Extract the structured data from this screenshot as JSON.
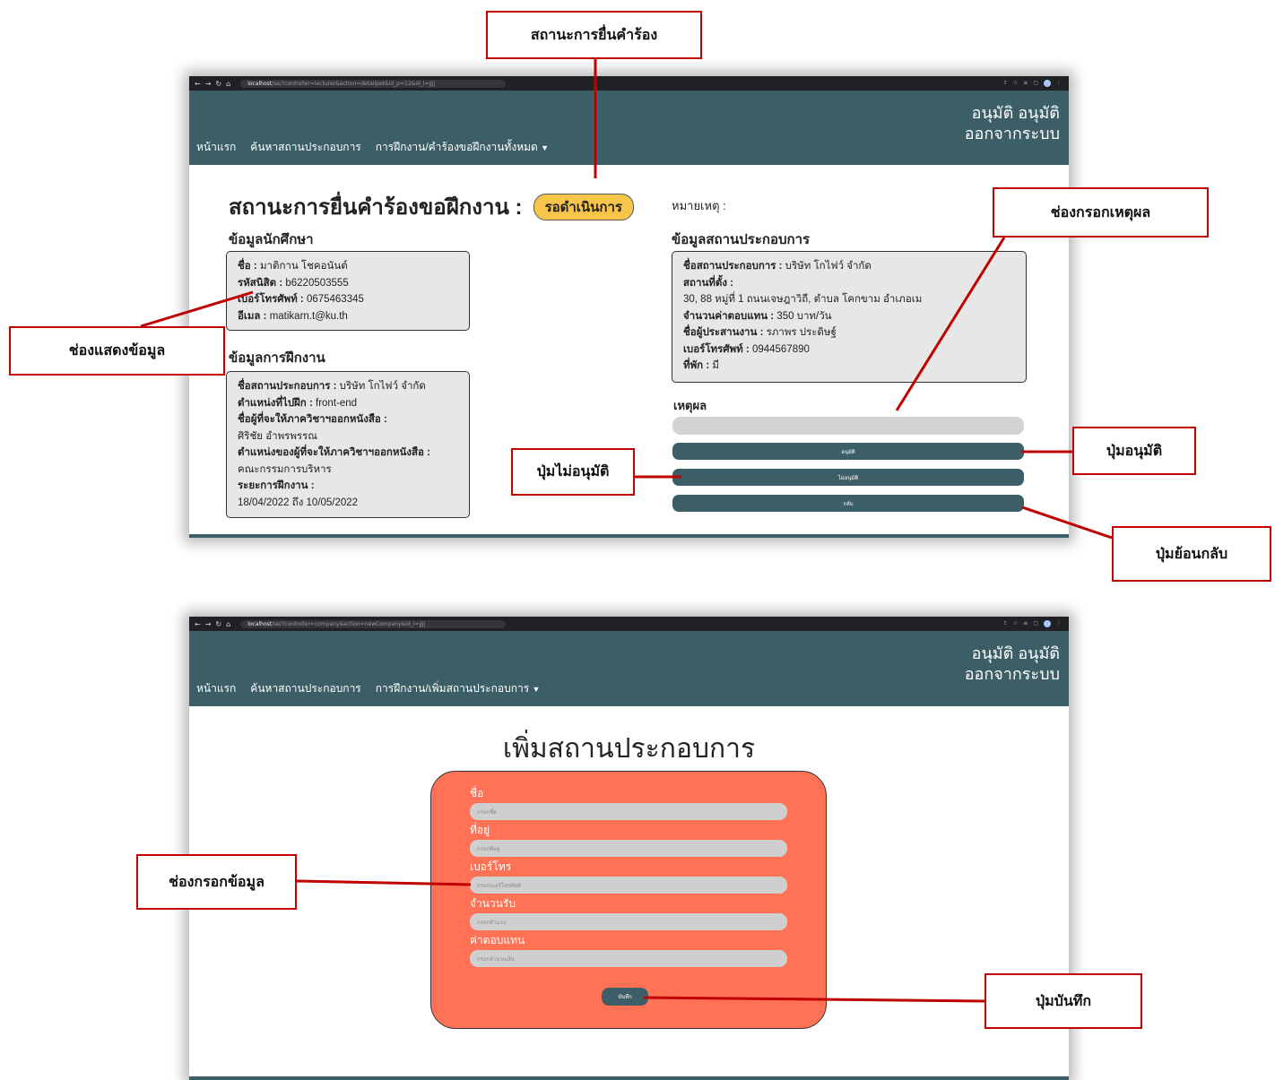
{
  "colors": {
    "navbar": "#3c5f67",
    "badge": "#f7c54a",
    "form_card": "#ff7256",
    "callout_border": "#c00000"
  },
  "callouts": {
    "status": "สถานะการยื่นคำร้อง",
    "reason_field": "ช่องกรอกเหตุผล",
    "display_field": "ช่องแสดงข้อมูล",
    "approve_button": "ปุ่มอนุมัติ",
    "reject_button": "ปุ่มไม่อนุมัติ",
    "back_button": "ปุ่มย้อนกลับ",
    "input_field": "ช่องกรอกข้อมูล",
    "save_button": "ปุ่มบันทึก"
  },
  "screen1": {
    "url_host": "localhost",
    "url_path": "/se/?controller=lecturer&action=detailpet&id_p=12&id_l=jjjj",
    "nav": {
      "home": "หน้าแรก",
      "search": "ค้นหาสถานประกอบการ",
      "dropdown": "การฝึกงาน/คำร้องขอฝึกงานทั้งหมด",
      "user_name": "อนุมัติ อนุมัติ",
      "logout": "ออกจากระบบ"
    },
    "title": "สถานะการยื่นคำร้องขอฝึกงาน :",
    "badge": "รอดำเนินการ",
    "note": "หมายเหตุ :",
    "student": {
      "heading": "ข้อมูลนักศึกษา",
      "name_label": "ชื่อ :",
      "name": "มาติกาน โชคอนันต์",
      "id_label": "รหัสนิสิต :",
      "id": "b6220503555",
      "phone_label": "เบอร์โทรศัพท์ :",
      "phone": "0675463345",
      "email_label": "อีเมล :",
      "email": "matikarn.t@ku.th"
    },
    "internship": {
      "heading": "ข้อมูลการฝึกงาน",
      "company_label": "ชื่อสถานประกอบการ :",
      "company": "บริษัท โกไฟว์ จำกัด",
      "position_label": "ตำแหน่งที่ไปฝึก :",
      "position": "front-end",
      "signer_label": "ชื่อผู้ที่จะให้ภาควิชาฯออกหนังสือ :",
      "signer": "ศิริชัย อำพรพรรณ",
      "signer_pos_label": "ตำแหน่งของผู้ที่จะให้ภาควิชาฯออกหนังสือ :",
      "signer_pos": "คณะกรรมการบริหาร",
      "period_label": "ระยะการฝึกงาน :",
      "period": "18/04/2022 ถึง 10/05/2022"
    },
    "company": {
      "heading": "ข้อมูลสถานประกอบการ",
      "name_label": "ชื่อสถานประกอบการ :",
      "name": "บริษัท โกไฟว์ จำกัด",
      "address_label": "สถานที่ตั้ง :",
      "address": "30, 88 หมู่ที่ 1 ถนนเจษฎาวิถี, ตำบล โคกขาม อำเภอเม",
      "pay_label": "จำนวนค่าตอบแทน :",
      "pay": "350 บาท/วัน",
      "coord_label": "ชื่อผู้ประสานงาน :",
      "coord": "รภาพร ประดิษฐ์",
      "phone_label": "เบอร์โทรศัพท์ :",
      "phone": "0944567890",
      "lodging_label": "ที่พัก :",
      "lodging": "มี"
    },
    "reason_label": "เหตุผล",
    "approve": "อนุมัติ",
    "reject": "ไม่อนุมัติ",
    "back": "กลับ"
  },
  "screen2": {
    "url_host": "localhost",
    "url_path": "/se/?controller=company&action=newCompany&id_l=jjjj",
    "nav": {
      "home": "หน้าแรก",
      "search": "ค้นหาสถานประกอบการ",
      "dropdown": "การฝึกงาน/เพิ่มสถานประกอบการ",
      "user_name": "อนุมัติ อนุมัติ",
      "logout": "ออกจากระบบ"
    },
    "title": "เพิ่มสถานประกอบการ",
    "fields": [
      {
        "label": "ชื่อ",
        "placeholder": "กรอกชื่อ"
      },
      {
        "label": "ที่อยู่",
        "placeholder": "กรอกที่อยู่"
      },
      {
        "label": "เบอร์โทร",
        "placeholder": "กรอกเบอร์โทรศัพท์"
      },
      {
        "label": "จำนวนรับ",
        "placeholder": "กรอกจำนวน"
      },
      {
        "label": "ค่าตอบแทน",
        "placeholder": "กรอกจำนวนเงิน"
      }
    ],
    "save": "บันทึก"
  }
}
